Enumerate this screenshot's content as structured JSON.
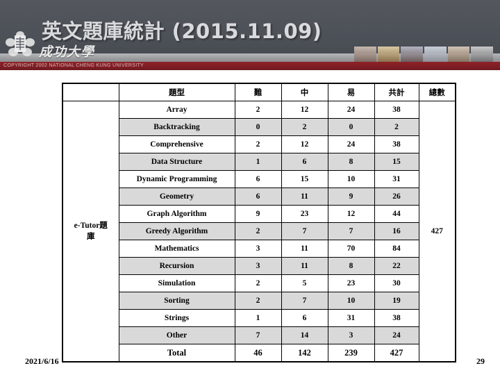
{
  "slide": {
    "title": "英文題庫統計 (2015.11.09)",
    "footer_date": "2021/6/16",
    "page_number": "29"
  },
  "banner": {
    "wordmark": "成功大學",
    "copyright": "COPYRIGHT 2002 NATIONAL CHENG KUNG UNIVERSITY",
    "seal_icon": "ncku-seal-icon",
    "colors": {
      "header_bg": "#4c5057",
      "gray_band": "#9a9b9d",
      "copy_bar": "#7d1e24",
      "title_text": "#d9dadd"
    }
  },
  "table": {
    "owner_label_line1": "e-Tutor題",
    "owner_label_line2": "庫",
    "headers": {
      "blank": "",
      "type": "題型",
      "hard": "難",
      "medium": "中",
      "easy": "易",
      "subtotal": "共計",
      "grand": "總數"
    },
    "grand_total": "427",
    "colors": {
      "hard": "#93141c",
      "medium": "#d08a2a",
      "easy": "#1f8a5a",
      "subtotal": "#000000",
      "alt_row_bg": "#d9d9d9"
    },
    "rows": [
      {
        "type": "Array",
        "hard": "2",
        "medium": "12",
        "easy": "24",
        "subtotal": "38"
      },
      {
        "type": "Backtracking",
        "hard": "0",
        "medium": "2",
        "easy": "0",
        "subtotal": "2"
      },
      {
        "type": "Comprehensive",
        "hard": "2",
        "medium": "12",
        "easy": "24",
        "subtotal": "38"
      },
      {
        "type": "Data Structure",
        "hard": "1",
        "medium": "6",
        "easy": "8",
        "subtotal": "15"
      },
      {
        "type": "Dynamic Programming",
        "hard": "6",
        "medium": "15",
        "easy": "10",
        "subtotal": "31"
      },
      {
        "type": "Geometry",
        "hard": "6",
        "medium": "11",
        "easy": "9",
        "subtotal": "26"
      },
      {
        "type": "Graph Algorithm",
        "hard": "9",
        "medium": "23",
        "easy": "12",
        "subtotal": "44"
      },
      {
        "type": "Greedy Algorithm",
        "hard": "2",
        "medium": "7",
        "easy": "7",
        "subtotal": "16"
      },
      {
        "type": "Mathematics",
        "hard": "3",
        "medium": "11",
        "easy": "70",
        "subtotal": "84"
      },
      {
        "type": "Recursion",
        "hard": "3",
        "medium": "11",
        "easy": "8",
        "subtotal": "22"
      },
      {
        "type": "Simulation",
        "hard": "2",
        "medium": "5",
        "easy": "23",
        "subtotal": "30"
      },
      {
        "type": "Sorting",
        "hard": "2",
        "medium": "7",
        "easy": "10",
        "subtotal": "19"
      },
      {
        "type": "Strings",
        "hard": "1",
        "medium": "6",
        "easy": "31",
        "subtotal": "38"
      },
      {
        "type": "Other",
        "hard": "7",
        "medium": "14",
        "easy": "3",
        "subtotal": "24"
      },
      {
        "type": "Total",
        "hard": "46",
        "medium": "142",
        "easy": "239",
        "subtotal": "427"
      }
    ]
  },
  "chart_data": {
    "type": "table",
    "title": "英文題庫統計 (2015.11.09)",
    "categories": [
      "Array",
      "Backtracking",
      "Comprehensive",
      "Data Structure",
      "Dynamic Programming",
      "Geometry",
      "Graph Algorithm",
      "Greedy Algorithm",
      "Mathematics",
      "Recursion",
      "Simulation",
      "Sorting",
      "Strings",
      "Other"
    ],
    "series": [
      {
        "name": "難",
        "values": [
          2,
          0,
          2,
          1,
          6,
          6,
          9,
          2,
          3,
          3,
          2,
          2,
          1,
          7
        ],
        "total": 46
      },
      {
        "name": "中",
        "values": [
          12,
          2,
          12,
          6,
          15,
          11,
          23,
          7,
          11,
          11,
          5,
          7,
          6,
          14
        ],
        "total": 142
      },
      {
        "name": "易",
        "values": [
          24,
          0,
          24,
          8,
          10,
          9,
          12,
          7,
          70,
          8,
          23,
          10,
          31,
          3
        ],
        "total": 239
      },
      {
        "name": "共計",
        "values": [
          38,
          2,
          38,
          15,
          31,
          26,
          44,
          16,
          84,
          22,
          30,
          19,
          38,
          24
        ],
        "total": 427
      }
    ],
    "grand_total": 427
  }
}
